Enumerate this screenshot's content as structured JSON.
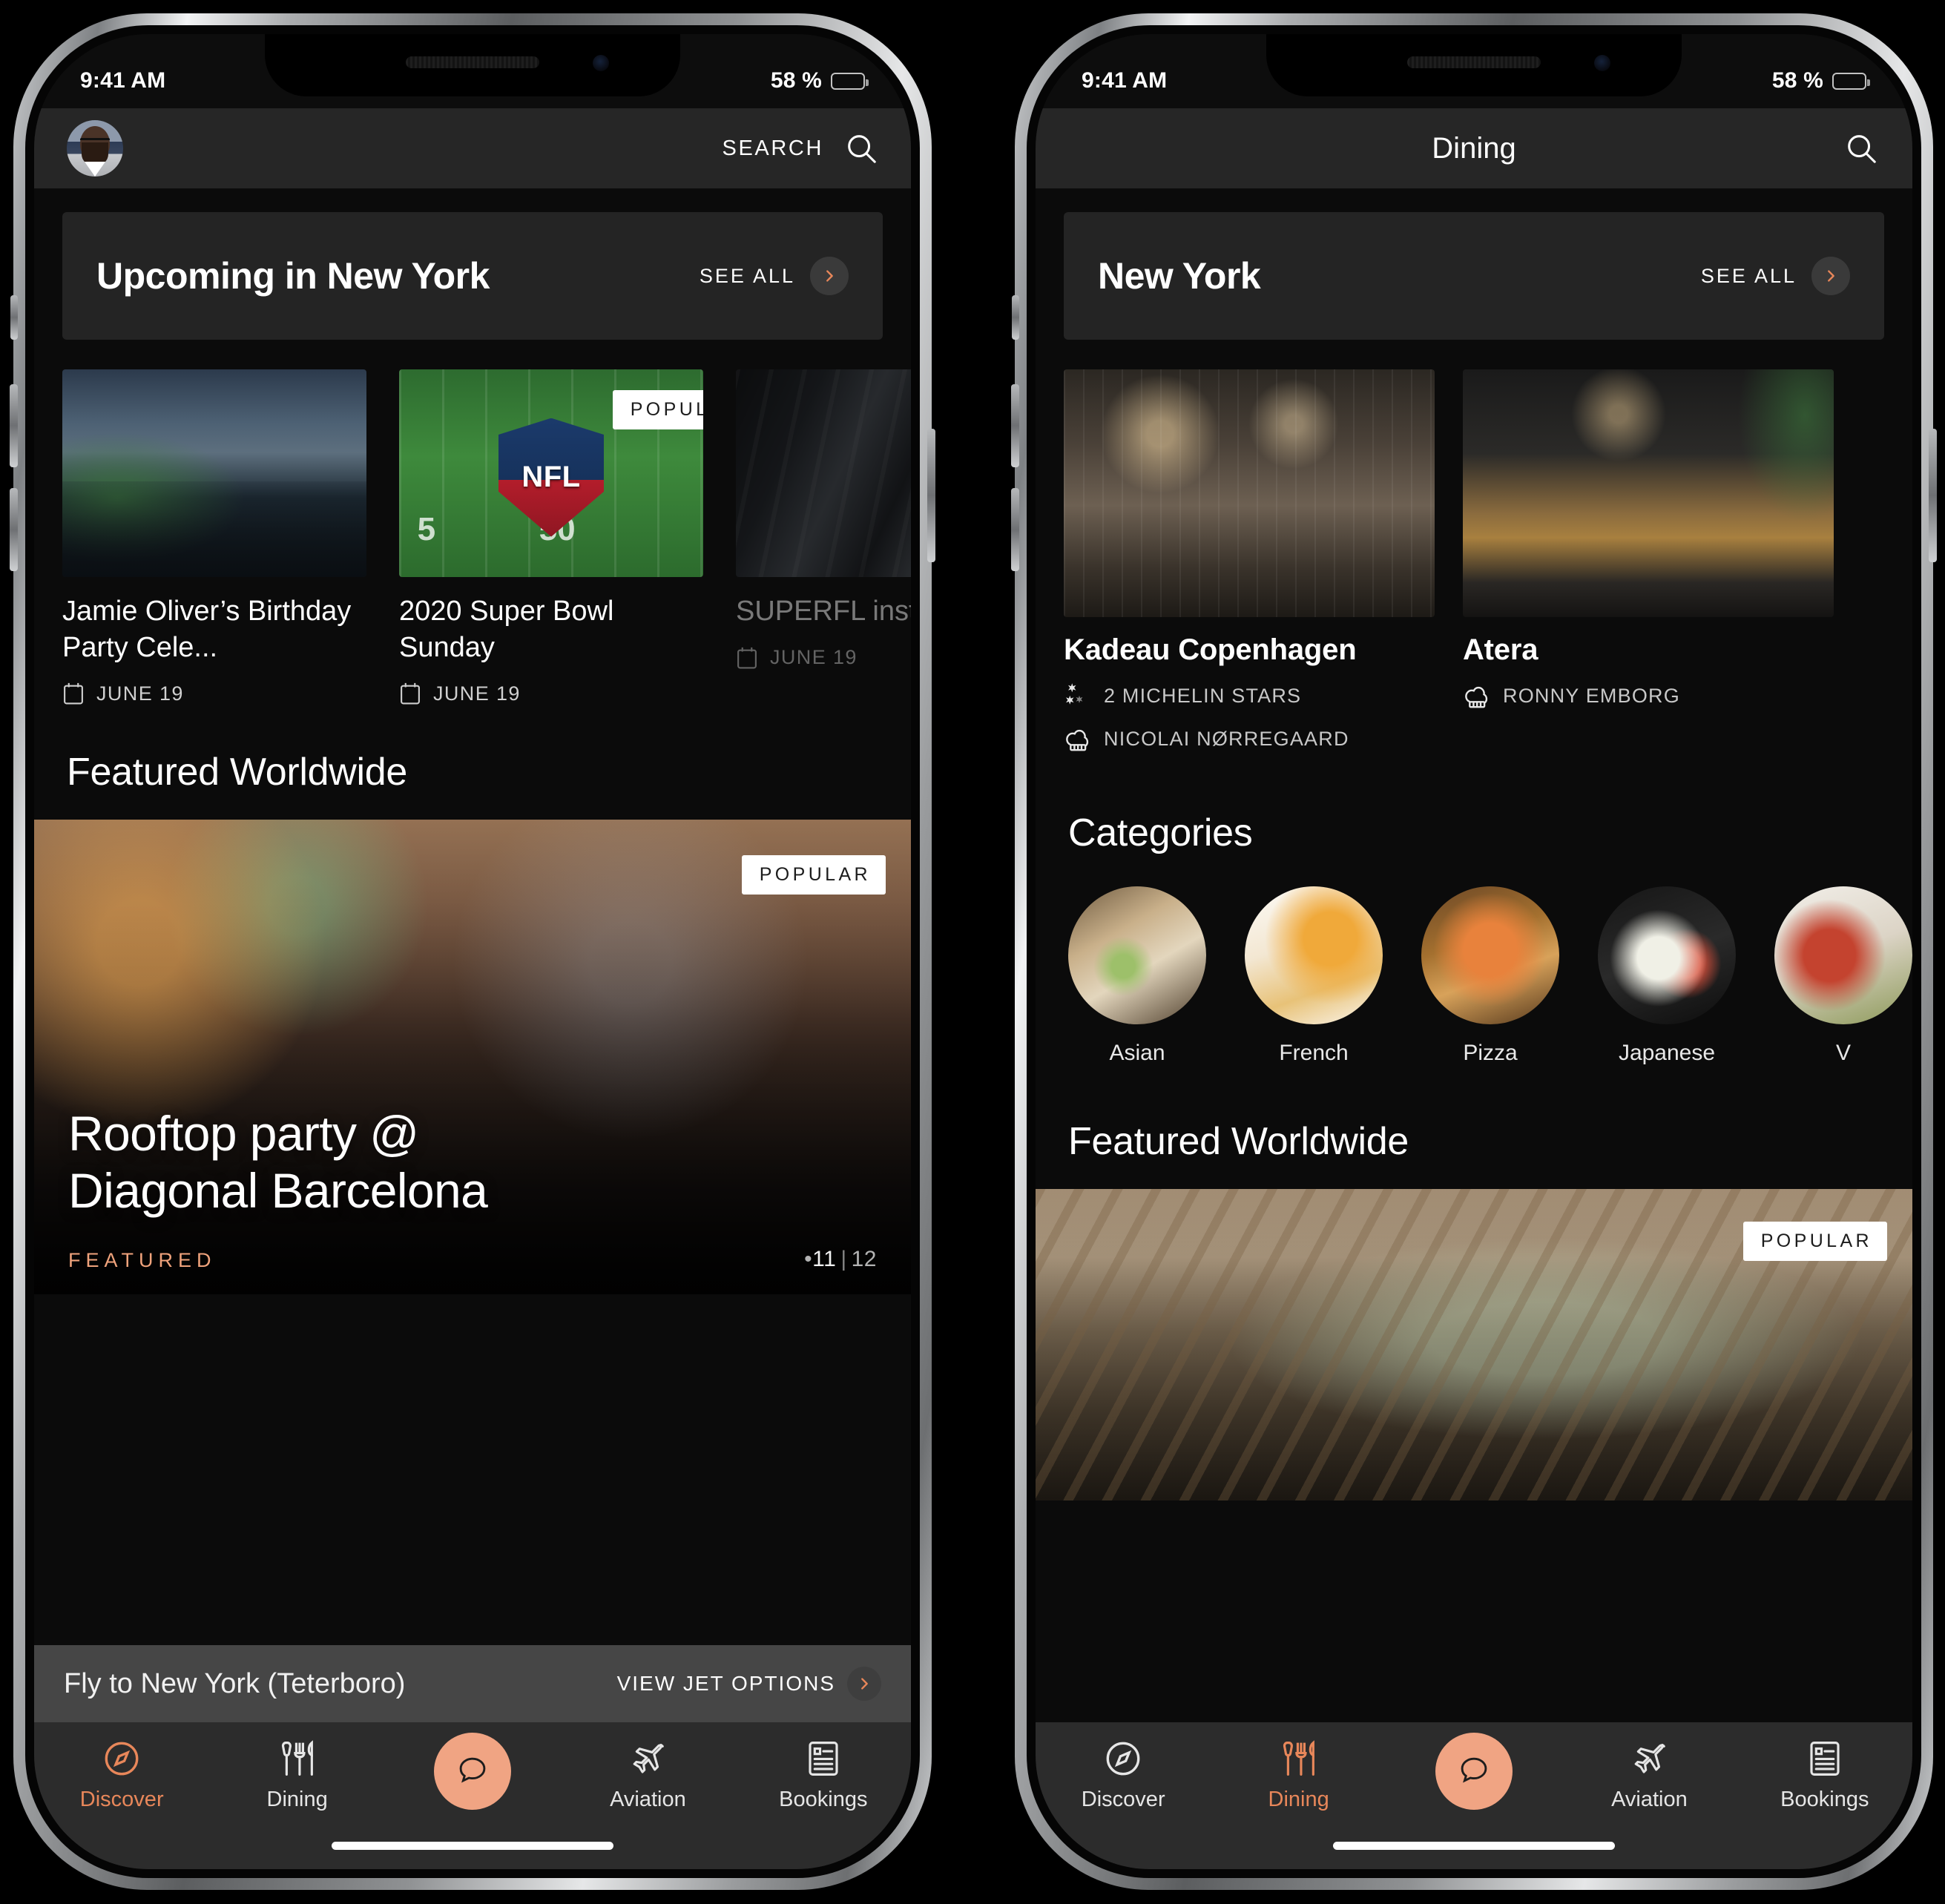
{
  "status_bar": {
    "time": "9:41 AM",
    "battery_text": "58 %",
    "battery_percent": 58
  },
  "colors": {
    "accent": "#e8875a",
    "fab": "#f0a483",
    "featured_tag": "#f0a37c",
    "card_bg": "#242424",
    "screen_bg": "#0b0b0b",
    "navbar_bg": "#262626",
    "tabbar_bg": "#2c2c2c"
  },
  "phone_left": {
    "navbar": {
      "search_label": "SEARCH",
      "search_icon": "search-icon",
      "avatar_icon": "user-avatar"
    },
    "city_banner": {
      "title": "Upcoming in New York",
      "see_all": "SEE ALL",
      "chevron_icon": "chevron-right-icon"
    },
    "events": [
      {
        "title": "Jamie Oliver’s Birthday Party Cele...",
        "date": "JUNE 19",
        "date_icon": "calendar-icon",
        "badge": ""
      },
      {
        "title": "2020 Super Bowl Sunday",
        "date": "JUNE 19",
        "date_icon": "calendar-icon",
        "badge": "POPULAR"
      },
      {
        "title": "SUPERFL installatio",
        "date": "JUNE 19",
        "date_icon": "calendar-icon",
        "badge": ""
      }
    ],
    "featured_heading": "Featured Worldwide",
    "hero": {
      "badge": "POPULAR",
      "title_line1": "Rooftop party @",
      "title_line2": "Diagonal Barcelona",
      "tag": "FEATURED",
      "counter_current": "11",
      "counter_separator": "|",
      "counter_total": "12",
      "counter_dot": "•"
    },
    "fly_bar": {
      "label": "Fly to New York (Teterboro)",
      "action": "VIEW JET OPTIONS",
      "chevron_icon": "chevron-right-icon"
    },
    "tabs": [
      {
        "label": "Discover",
        "icon": "compass-icon",
        "active": true
      },
      {
        "label": "Dining",
        "icon": "utensils-icon",
        "active": false
      },
      {
        "label": "",
        "icon": "chat-bubble-icon",
        "active": false
      },
      {
        "label": "Aviation",
        "icon": "airplane-icon",
        "active": false
      },
      {
        "label": "Bookings",
        "icon": "list-document-icon",
        "active": false
      }
    ]
  },
  "phone_right": {
    "navbar": {
      "title": "Dining",
      "search_icon": "search-icon"
    },
    "city_banner": {
      "title": "New York",
      "see_all": "SEE ALL",
      "chevron_icon": "chevron-right-icon"
    },
    "restaurants": [
      {
        "name": "Kadeau Copenhagen",
        "meta": [
          {
            "icon": "michelin-stars-icon",
            "text": "2 MICHELIN STARS"
          },
          {
            "icon": "chef-hat-icon",
            "text": "NICOLAI NØRREGAARD"
          }
        ]
      },
      {
        "name": "Atera",
        "meta": [
          {
            "icon": "chef-hat-icon",
            "text": "RONNY EMBORG"
          }
        ]
      }
    ],
    "categories_heading": "Categories",
    "categories": [
      {
        "label": "Asian"
      },
      {
        "label": "French"
      },
      {
        "label": "Pizza"
      },
      {
        "label": "Japanese"
      },
      {
        "label": "V"
      }
    ],
    "featured_heading": "Featured Worldwide",
    "hero": {
      "badge": "POPULAR"
    },
    "tabs": [
      {
        "label": "Discover",
        "icon": "compass-icon",
        "active": false
      },
      {
        "label": "Dining",
        "icon": "utensils-icon",
        "active": true
      },
      {
        "label": "",
        "icon": "chat-bubble-icon",
        "active": false
      },
      {
        "label": "Aviation",
        "icon": "airplane-icon",
        "active": false
      },
      {
        "label": "Bookings",
        "icon": "list-document-icon",
        "active": false
      }
    ]
  }
}
